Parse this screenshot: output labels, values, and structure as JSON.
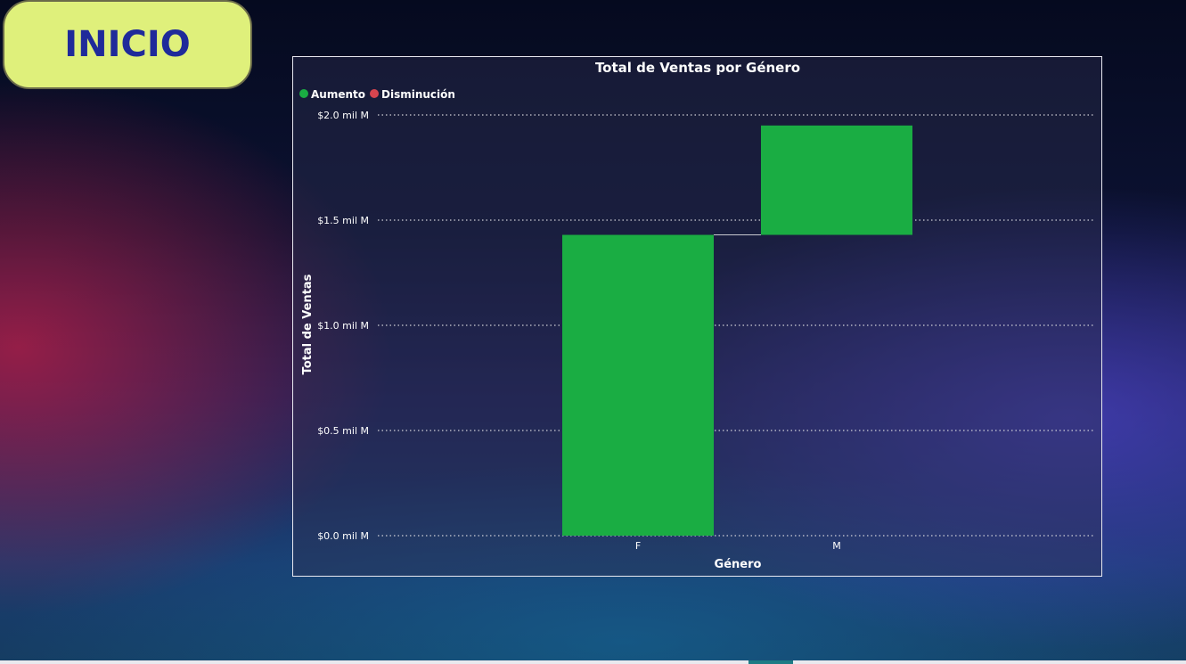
{
  "nav": {
    "home_label": "INICIO"
  },
  "chart_data": {
    "type": "waterfall",
    "title": "Total de Ventas por Género",
    "xlabel": "Género",
    "ylabel": "Total de Ventas",
    "legend": {
      "placement": "top-left",
      "items": [
        {
          "label": "Aumento",
          "color": "#1aad43"
        },
        {
          "label": "Disminución",
          "color": "#d6454f"
        }
      ]
    },
    "categories": [
      "F",
      "M"
    ],
    "values": [
      1.43,
      0.52
    ],
    "ylim": [
      0,
      2.0
    ],
    "yticks": [
      {
        "value": 0.0,
        "label": "$0.0 mil M"
      },
      {
        "value": 0.5,
        "label": "$0.5 mil M"
      },
      {
        "value": 1.0,
        "label": "$1.0 mil M"
      },
      {
        "value": 1.5,
        "label": "$1.5 mil M"
      },
      {
        "value": 2.0,
        "label": "$2.0 mil M"
      }
    ],
    "grid": true,
    "colors": {
      "increase": "#1aad43",
      "decrease": "#d6454f",
      "text": "#ffffff",
      "grid": "#d0d0d8"
    }
  }
}
